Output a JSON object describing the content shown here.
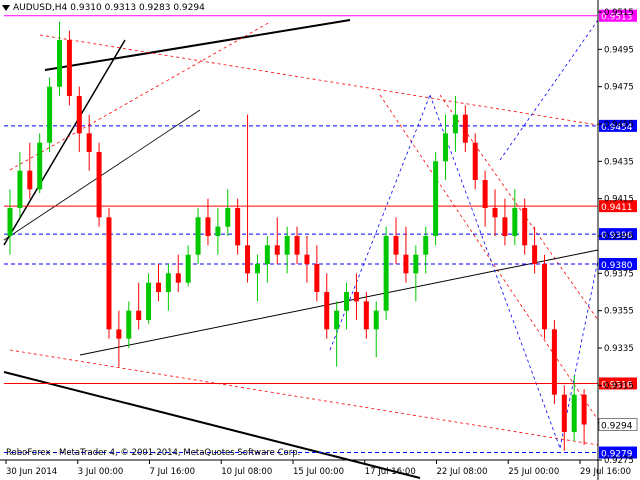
{
  "header": {
    "symbol": "AUDUSD,H4",
    "ohlc": "0.9310 0.9313 0.9283 0.9294"
  },
  "copyright": "RoboForex - MetaTrader 4, © 2001-2014, MetaQuotes Software Corp.",
  "colors": {
    "background": "#ffffff",
    "bull": "#00c800",
    "bear": "#ff0000",
    "hline_red": "#ff0000",
    "hline_blue": "#0000ff",
    "hline_magenta": "#ff00ff",
    "axis": "#000000"
  },
  "chart_data": {
    "type": "candlestick",
    "y_axis": {
      "min": 0.9275,
      "max": 0.9515,
      "ticks": [
        "0.9515",
        "0.9495",
        "0.9475",
        "0.9455",
        "0.9435",
        "0.9415",
        "0.9395",
        "0.9375",
        "0.9355",
        "0.9335",
        "0.9315",
        "0.9295",
        "0.9275"
      ]
    },
    "x_axis": {
      "labels": [
        "30 Jun 2014",
        "3 Jul 00:00",
        "7 Jul 16:00",
        "10 Jul 08:00",
        "15 Jul 00:00",
        "17 Jul 16:00",
        "22 Jul 08:00",
        "25 Jul 00:00",
        "29 Jul 16:00"
      ]
    },
    "price_levels": [
      {
        "price": 0.9513,
        "label": "0.9513",
        "color": "#ff00ff"
      },
      {
        "price": 0.9454,
        "label": "0.9454",
        "color": "#0000ff"
      },
      {
        "price": 0.9411,
        "label": "0.9411",
        "color": "#ff0000"
      },
      {
        "price": 0.9396,
        "label": "0.9396",
        "color": "#0000ff"
      },
      {
        "price": 0.938,
        "label": "0.9380",
        "color": "#0000ff"
      },
      {
        "price": 0.9316,
        "label": "0.9316",
        "color": "#ff0000"
      },
      {
        "price": 0.9279,
        "label": "0.9279",
        "color": "#0000ff"
      }
    ],
    "current_price": {
      "price": 0.9294,
      "label": "0.9294"
    },
    "candles": [
      [
        0.9395,
        0.942,
        0.9385,
        0.941
      ],
      [
        0.941,
        0.944,
        0.9405,
        0.943
      ],
      [
        0.943,
        0.9445,
        0.9415,
        0.942
      ],
      [
        0.942,
        0.945,
        0.9418,
        0.9445
      ],
      [
        0.9445,
        0.948,
        0.944,
        0.9475
      ],
      [
        0.9475,
        0.951,
        0.947,
        0.95
      ],
      [
        0.95,
        0.9505,
        0.9465,
        0.947
      ],
      [
        0.947,
        0.9475,
        0.944,
        0.945
      ],
      [
        0.945,
        0.946,
        0.943,
        0.944
      ],
      [
        0.944,
        0.9445,
        0.94,
        0.9405
      ],
      [
        0.9405,
        0.941,
        0.934,
        0.9345
      ],
      [
        0.9345,
        0.9355,
        0.9325,
        0.934
      ],
      [
        0.934,
        0.936,
        0.9335,
        0.9355
      ],
      [
        0.9355,
        0.937,
        0.9345,
        0.935
      ],
      [
        0.935,
        0.9375,
        0.9348,
        0.937
      ],
      [
        0.937,
        0.938,
        0.936,
        0.9365
      ],
      [
        0.9365,
        0.938,
        0.9355,
        0.9375
      ],
      [
        0.9375,
        0.9385,
        0.9365,
        0.937
      ],
      [
        0.937,
        0.939,
        0.9368,
        0.9385
      ],
      [
        0.9385,
        0.941,
        0.938,
        0.9405
      ],
      [
        0.9405,
        0.9415,
        0.939,
        0.9395
      ],
      [
        0.9395,
        0.941,
        0.9385,
        0.94
      ],
      [
        0.94,
        0.942,
        0.9395,
        0.941
      ],
      [
        0.941,
        0.9415,
        0.9385,
        0.939
      ],
      [
        0.939,
        0.946,
        0.937,
        0.9375
      ],
      [
        0.9375,
        0.9385,
        0.936,
        0.938
      ],
      [
        0.938,
        0.9395,
        0.937,
        0.939
      ],
      [
        0.939,
        0.9405,
        0.938,
        0.9385
      ],
      [
        0.9385,
        0.94,
        0.9375,
        0.9395
      ],
      [
        0.9395,
        0.94,
        0.938,
        0.9385
      ],
      [
        0.9385,
        0.9395,
        0.937,
        0.938
      ],
      [
        0.938,
        0.939,
        0.936,
        0.9365
      ],
      [
        0.9365,
        0.9375,
        0.934,
        0.9345
      ],
      [
        0.9345,
        0.936,
        0.9325,
        0.9355
      ],
      [
        0.9355,
        0.937,
        0.9345,
        0.9365
      ],
      [
        0.9365,
        0.9375,
        0.935,
        0.936
      ],
      [
        0.936,
        0.9365,
        0.934,
        0.9345
      ],
      [
        0.9345,
        0.936,
        0.933,
        0.9355
      ],
      [
        0.9355,
        0.94,
        0.935,
        0.9395
      ],
      [
        0.9395,
        0.9405,
        0.938,
        0.9385
      ],
      [
        0.9385,
        0.94,
        0.937,
        0.9375
      ],
      [
        0.9375,
        0.939,
        0.936,
        0.9385
      ],
      [
        0.9385,
        0.94,
        0.9375,
        0.9395
      ],
      [
        0.9395,
        0.944,
        0.939,
        0.9435
      ],
      [
        0.9435,
        0.946,
        0.9425,
        0.945
      ],
      [
        0.945,
        0.947,
        0.944,
        0.946
      ],
      [
        0.946,
        0.9465,
        0.944,
        0.9445
      ],
      [
        0.9445,
        0.945,
        0.942,
        0.9425
      ],
      [
        0.9425,
        0.943,
        0.94,
        0.941
      ],
      [
        0.941,
        0.942,
        0.9395,
        0.9405
      ],
      [
        0.9405,
        0.9415,
        0.939,
        0.9395
      ],
      [
        0.9395,
        0.942,
        0.939,
        0.941
      ],
      [
        0.941,
        0.9415,
        0.9385,
        0.939
      ],
      [
        0.939,
        0.94,
        0.9375,
        0.938
      ],
      [
        0.938,
        0.9385,
        0.934,
        0.9345
      ],
      [
        0.9345,
        0.935,
        0.9305,
        0.931
      ],
      [
        0.931,
        0.9315,
        0.928,
        0.929
      ],
      [
        0.929,
        0.932,
        0.9285,
        0.931
      ],
      [
        0.931,
        0.9313,
        0.9283,
        0.9294
      ]
    ]
  }
}
